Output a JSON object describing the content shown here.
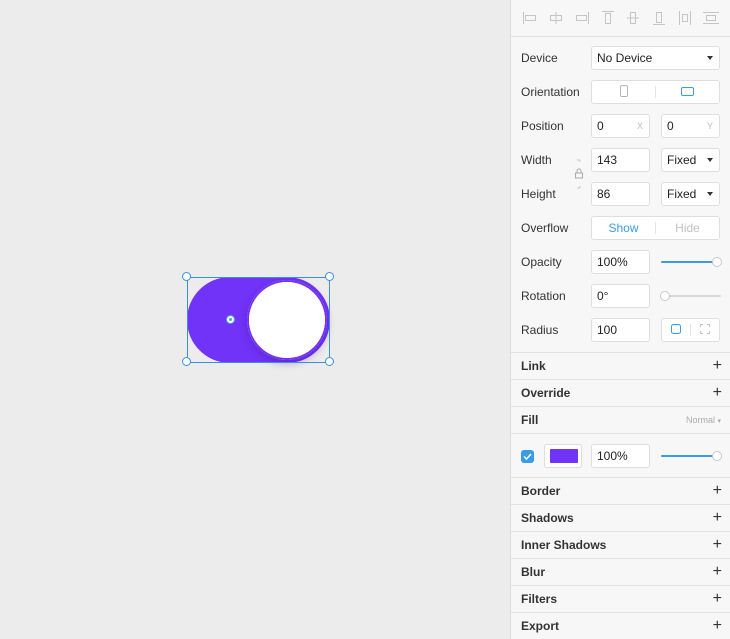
{
  "canvas": {
    "toggle_track_color": "#7133f7",
    "selection_color": "#3a8ee6"
  },
  "align_icons": [
    "align-left-icon",
    "align-horizontal-center-icon",
    "align-right-icon",
    "align-top-icon",
    "align-vertical-center-icon",
    "align-bottom-icon",
    "distribute-horizontal-icon",
    "distribute-vertical-icon"
  ],
  "inspector": {
    "device": {
      "label": "Device",
      "value": "No Device"
    },
    "orientation": {
      "label": "Orientation",
      "selected": "landscape"
    },
    "position": {
      "label": "Position",
      "x": "0",
      "x_suffix": "X",
      "y": "0",
      "y_suffix": "Y"
    },
    "width": {
      "label": "Width",
      "value": "143",
      "mode": "Fixed"
    },
    "height": {
      "label": "Height",
      "value": "86",
      "mode": "Fixed"
    },
    "overflow": {
      "label": "Overflow",
      "show": "Show",
      "hide": "Hide",
      "selected": "Show"
    },
    "opacity": {
      "label": "Opacity",
      "value": "100%",
      "level": 1.0
    },
    "rotation": {
      "label": "Rotation",
      "value": "0°",
      "level": 0.0
    },
    "radius": {
      "label": "Radius",
      "value": "100"
    }
  },
  "sections": {
    "link": "Link",
    "override": "Override",
    "fill": "Fill",
    "fill_mode": "Normal",
    "border": "Border",
    "shadows": "Shadows",
    "inner_shadows": "Inner Shadows",
    "blur": "Blur",
    "filters": "Filters",
    "export": "Export",
    "plus": "+"
  },
  "fill": {
    "enabled": true,
    "color": "#7133f7",
    "opacity": "100%",
    "level": 1.0
  },
  "accent": "#3a9be8"
}
